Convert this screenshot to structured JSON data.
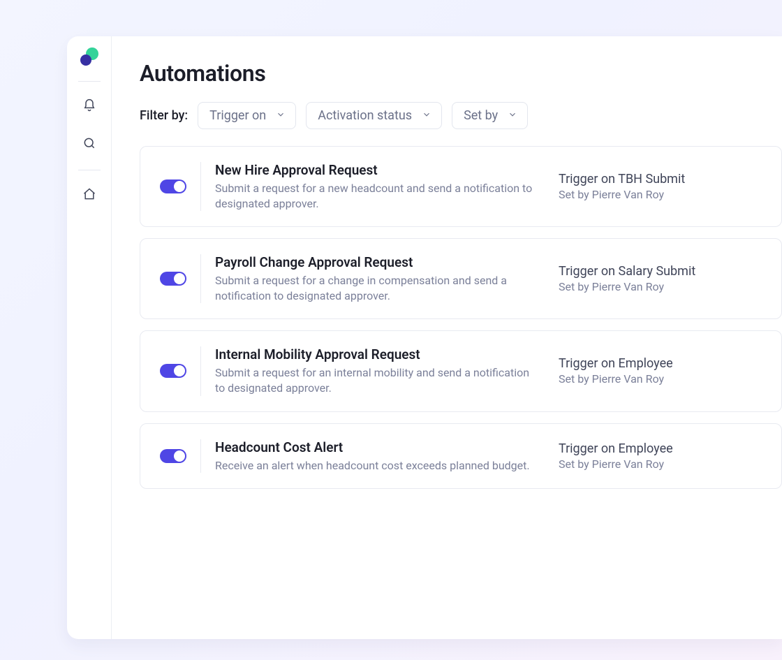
{
  "page": {
    "title": "Automations",
    "filter_label": "Filter by:"
  },
  "filters": [
    {
      "label": "Trigger on"
    },
    {
      "label": "Activation status"
    },
    {
      "label": "Set by"
    }
  ],
  "automations": [
    {
      "enabled": true,
      "title": "New Hire Approval Request",
      "description": "Submit a request for a new headcount and send a notification to designated approver.",
      "trigger": "Trigger on TBH Submit",
      "set_by": "Set by Pierre Van Roy"
    },
    {
      "enabled": true,
      "title": "Payroll Change Approval Request",
      "description": "Submit a request for a change in compensation and send a notification to designated approver.",
      "trigger": "Trigger on Salary Submit",
      "set_by": "Set by Pierre Van Roy"
    },
    {
      "enabled": true,
      "title": "Internal Mobility Approval Request",
      "description": "Submit a request for an internal mobility and send a notification to designated approver.",
      "trigger": "Trigger on Employee",
      "set_by": "Set by Pierre Van Roy"
    },
    {
      "enabled": true,
      "title": "Headcount Cost Alert",
      "description": "Receive an alert when headcount cost exceeds planned budget.",
      "trigger": "Trigger on Employee",
      "set_by": "Set by Pierre Van Roy"
    }
  ]
}
